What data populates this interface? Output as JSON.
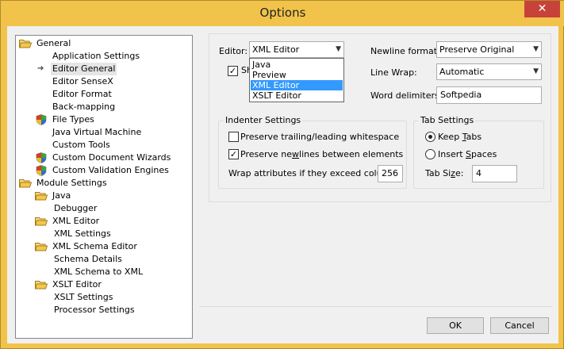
{
  "window": {
    "title": "Options",
    "close_glyph": "✕"
  },
  "tree": {
    "items": [
      {
        "label": "General",
        "icon": "folder-open-icon",
        "level": 0
      },
      {
        "label": "Application Settings",
        "icon": "",
        "level": 1
      },
      {
        "label": "Editor General",
        "icon": "arrow-icon",
        "level": 1,
        "selected": true
      },
      {
        "label": "Editor SenseX",
        "icon": "",
        "level": 1
      },
      {
        "label": "Editor Format",
        "icon": "",
        "level": 1
      },
      {
        "label": "Back-mapping",
        "icon": "",
        "level": 1
      },
      {
        "label": "File Types",
        "icon": "shield-icon",
        "level": 1
      },
      {
        "label": "Java Virtual Machine",
        "icon": "",
        "level": 1
      },
      {
        "label": "Custom Tools",
        "icon": "",
        "level": 1
      },
      {
        "label": "Custom Document Wizards",
        "icon": "shield-icon",
        "level": 1
      },
      {
        "label": "Custom Validation Engines",
        "icon": "shield-icon",
        "level": 1
      },
      {
        "label": "Module Settings",
        "icon": "folder-open-icon",
        "level": 0
      },
      {
        "label": "Java",
        "icon": "folder-open-icon",
        "level": 1
      },
      {
        "label": "Debugger",
        "icon": "",
        "level": 2
      },
      {
        "label": "XML Editor",
        "icon": "folder-open-icon",
        "level": 1
      },
      {
        "label": "XML Settings",
        "icon": "",
        "level": 2
      },
      {
        "label": "XML Schema Editor",
        "icon": "folder-open-icon",
        "level": 1
      },
      {
        "label": "Schema Details",
        "icon": "",
        "level": 2
      },
      {
        "label": "XML Schema to XML",
        "icon": "",
        "level": 2
      },
      {
        "label": "XSLT Editor",
        "icon": "folder-open-icon",
        "level": 1
      },
      {
        "label": "XSLT Settings",
        "icon": "",
        "level": 2
      },
      {
        "label": "Processor Settings",
        "icon": "",
        "level": 2
      }
    ]
  },
  "editor": {
    "label": "Editor:",
    "value": "XML Editor",
    "options": [
      "Java",
      "Preview",
      "XML Editor",
      "XSLT Editor"
    ],
    "highlighted": "XML Editor",
    "show_checkbox_label_fragment": "Sh"
  },
  "newline": {
    "label": "Newline format:",
    "value": "Preserve Original"
  },
  "linewrap": {
    "label": "Line Wrap:",
    "value": "Automatic"
  },
  "delims": {
    "label": "Word delimiters:",
    "value": "Softpedia"
  },
  "indenter": {
    "title": "Indenter Settings",
    "preserve_ws": {
      "label": "Preserve trailing/leading whitespace",
      "checked": false
    },
    "preserve_nl": {
      "label_pre": "Preserve ne",
      "label_u": "w",
      "label_post": "lines between elements",
      "checked": true
    },
    "wrap": {
      "label": "Wrap attributes if they exceed column",
      "value": "256"
    }
  },
  "tabs": {
    "title": "Tab Settings",
    "keep": {
      "label_pre": "Keep ",
      "label_u": "T",
      "label_post": "abs",
      "selected": true
    },
    "insert": {
      "label_pre": "Insert ",
      "label_u": "S",
      "label_post": "paces",
      "selected": false
    },
    "size": {
      "label_pre": "Tab Si",
      "label_u": "z",
      "label_post": "e:",
      "value": "4"
    }
  },
  "buttons": {
    "ok": "OK",
    "cancel": "Cancel"
  },
  "colors": {
    "title_bar": "#f1c34a",
    "close": "#c7433a",
    "selection": "#3399ff"
  }
}
